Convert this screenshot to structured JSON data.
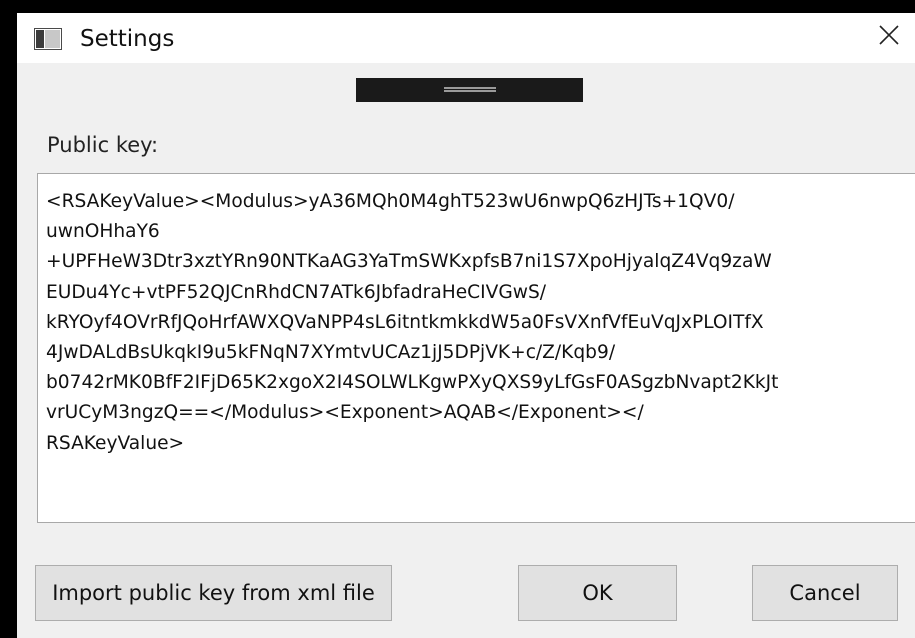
{
  "window": {
    "title": "Settings"
  },
  "icons": {
    "app": "window-app-icon",
    "close": "close-icon",
    "drag": "drag-grip-icon"
  },
  "colors": {
    "window_bg": "#f0f0f0",
    "titlebar_bg": "#ffffff",
    "button_bg": "#e1e1e1",
    "button_border": "#adadad"
  },
  "public_key": {
    "label": "Public key:",
    "value": "<RSAKeyValue><Modulus>yA36MQh0M4ghT523wU6nwpQ6zHJTs+1QV0/\nuwnOHhaY6\n+UPFHeW3Dtr3xztYRn90NTKaAG3YaTmSWKxpfsB7ni1S7XpoHjyalqZ4Vq9zaW\nEUDu4Yc+vtPF52QJCnRhdCN7ATk6JbfadraHeCIVGwS/\nkRYOyf4OVrRfJQoHrfAWXQVaNPP4sL6itntkmkkdW5a0FsVXnfVfEuVqJxPLOITfX\n4JwDALdBsUkqkI9u5kFNqN7XYmtvUCAz1jJ5DPjVK+c/Z/Kqb9/\nb0742rMK0BfF2IFjD65K2xgoX2I4SOLWLKgwPXyQXS9yLfGsF0ASgzbNvapt2KkJt\nvrUCyM3ngzQ==</Modulus><Exponent>AQAB</Exponent></\nRSAKeyValue>"
  },
  "buttons": {
    "import_label": "Import public key from xml file",
    "ok_label": "OK",
    "cancel_label": "Cancel"
  }
}
